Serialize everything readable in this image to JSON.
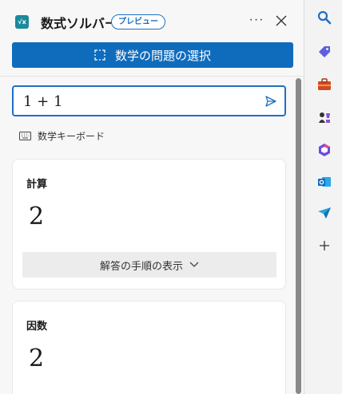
{
  "header": {
    "app_icon_text": "√x",
    "title": "数式ソルバー",
    "badge": "プレビュー",
    "more_label": "···"
  },
  "select_button": {
    "label": "数学の問題の選択"
  },
  "input": {
    "value": "1 + 1"
  },
  "keyboard": {
    "label": "数学キーボード"
  },
  "cards": [
    {
      "title": "計算",
      "result": "2",
      "steps_label": "解答の手順の表示"
    },
    {
      "title": "因数",
      "result": "2"
    }
  ],
  "right_bar": {
    "icons": [
      "search-icon",
      "tag-icon",
      "toolbox-icon",
      "chess-icon",
      "office-icon",
      "outlook-icon",
      "send-icon",
      "plus-icon"
    ]
  },
  "colors": {
    "accent": "#0f6cbd",
    "badge": "#1f6fc4",
    "app_icon": "#1b8a9c"
  }
}
